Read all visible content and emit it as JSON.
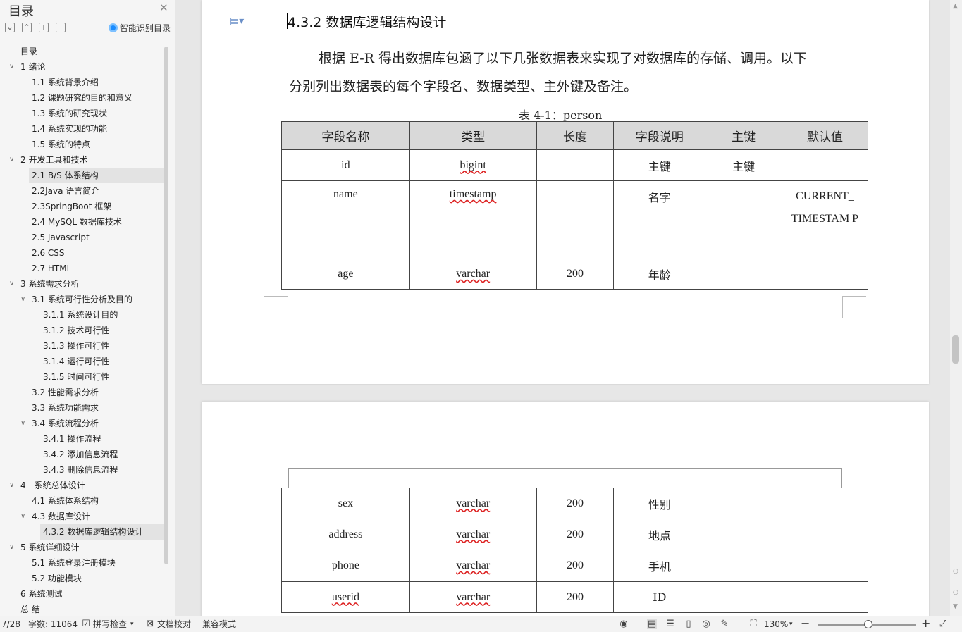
{
  "toc": {
    "title": "目录",
    "smart_toc": "智能识别目录",
    "items": [
      {
        "label": "目录",
        "level": 0,
        "chev": false,
        "selected": false
      },
      {
        "label": "1 绪论",
        "level": 0,
        "chev": true,
        "selected": false
      },
      {
        "label": "1.1 系统背景介绍",
        "level": 1,
        "chev": false,
        "selected": false
      },
      {
        "label": "1.2 课题研究的目的和意义",
        "level": 1,
        "chev": false,
        "selected": false
      },
      {
        "label": "1.3 系统的研究现状",
        "level": 1,
        "chev": false,
        "selected": false
      },
      {
        "label": "1.4 系统实现的功能",
        "level": 1,
        "chev": false,
        "selected": false
      },
      {
        "label": "1.5 系统的特点",
        "level": 1,
        "chev": false,
        "selected": false
      },
      {
        "label": "2 开发工具和技术",
        "level": 0,
        "chev": true,
        "selected": false
      },
      {
        "label": "2.1 B/S 体系结构",
        "level": 1,
        "chev": false,
        "selected": true
      },
      {
        "label": "2.2Java 语言简介",
        "level": 1,
        "chev": false,
        "selected": false
      },
      {
        "label": "2.3SpringBoot 框架",
        "level": 1,
        "chev": false,
        "selected": false
      },
      {
        "label": "2.4 MySQL 数据库技术",
        "level": 1,
        "chev": false,
        "selected": false
      },
      {
        "label": "2.5 Javascript",
        "level": 1,
        "chev": false,
        "selected": false
      },
      {
        "label": "2.6 CSS",
        "level": 1,
        "chev": false,
        "selected": false
      },
      {
        "label": "2.7 HTML",
        "level": 1,
        "chev": false,
        "selected": false
      },
      {
        "label": "3 系统需求分析",
        "level": 0,
        "chev": true,
        "selected": false
      },
      {
        "label": "3.1 系统可行性分析及目的",
        "level": 1,
        "chev": true,
        "selected": false
      },
      {
        "label": "3.1.1 系统设计目的",
        "level": 2,
        "chev": false,
        "selected": false
      },
      {
        "label": "3.1.2 技术可行性",
        "level": 2,
        "chev": false,
        "selected": false
      },
      {
        "label": "3.1.3 操作可行性",
        "level": 2,
        "chev": false,
        "selected": false
      },
      {
        "label": "3.1.4 运行可行性",
        "level": 2,
        "chev": false,
        "selected": false
      },
      {
        "label": "3.1.5 时间可行性",
        "level": 2,
        "chev": false,
        "selected": false
      },
      {
        "label": "3.2 性能需求分析",
        "level": 1,
        "chev": false,
        "selected": false
      },
      {
        "label": "3.3 系统功能需求",
        "level": 1,
        "chev": false,
        "selected": false
      },
      {
        "label": "3.4 系统流程分析",
        "level": 1,
        "chev": true,
        "selected": false
      },
      {
        "label": "3.4.1 操作流程",
        "level": 2,
        "chev": false,
        "selected": false
      },
      {
        "label": "3.4.2 添加信息流程",
        "level": 2,
        "chev": false,
        "selected": false
      },
      {
        "label": "3.4.3 删除信息流程",
        "level": 2,
        "chev": false,
        "selected": false
      },
      {
        "label": "4　系统总体设计",
        "level": 0,
        "chev": true,
        "selected": false
      },
      {
        "label": "4.1 系统体系结构",
        "level": 1,
        "chev": false,
        "selected": false
      },
      {
        "label": "4.3 数据库设计",
        "level": 1,
        "chev": true,
        "selected": false
      },
      {
        "label": "4.3.2 数据库逻辑结构设计",
        "level": 2,
        "chev": false,
        "selected": true
      },
      {
        "label": "5 系统详细设计",
        "level": 0,
        "chev": true,
        "selected": false
      },
      {
        "label": "5.1 系统登录注册模块",
        "level": 1,
        "chev": false,
        "selected": false
      },
      {
        "label": "5.2 功能模块",
        "level": 1,
        "chev": false,
        "selected": false
      },
      {
        "label": "6 系统测试",
        "level": 0,
        "chev": false,
        "selected": false
      },
      {
        "label": "总 结",
        "level": 0,
        "chev": false,
        "selected": false
      }
    ]
  },
  "document": {
    "heading": "4.3.2 数据库逻辑结构设计",
    "para_line1": "根据 E-R 得出数据库包涵了以下几张数据表来实现了对数据库的存储、调用。以下",
    "para_line2": "分别列出数据表的每个字段名、数据类型、主外键及备注。",
    "table_caption": "表 4-1：person",
    "table_headers": [
      "字段名称",
      "类型",
      "长度",
      "字段说明",
      "主键",
      "默认值"
    ],
    "table_rows_page1": [
      [
        "id",
        "bigint",
        "",
        "主键",
        "主键",
        ""
      ],
      [
        "name",
        "timestamp",
        "",
        "名字",
        "",
        "CURRENT_ TIMESTAM P"
      ],
      [
        "age",
        "varchar",
        "200",
        "年龄",
        "",
        ""
      ]
    ],
    "table_rows_page2": [
      [
        "sex",
        "varchar",
        "200",
        "性别",
        "",
        ""
      ],
      [
        "address",
        "varchar",
        "200",
        "地点",
        "",
        ""
      ],
      [
        "phone",
        "varchar",
        "200",
        "手机",
        "",
        ""
      ],
      [
        "userid",
        "varchar",
        "200",
        "ID",
        "",
        ""
      ]
    ]
  },
  "status_bar": {
    "page": "7/28",
    "word_count": "字数: 11064",
    "spell_check": "拼写检查",
    "doc_proof": "文档校对",
    "compat_mode": "兼容模式",
    "zoom": "130%"
  }
}
